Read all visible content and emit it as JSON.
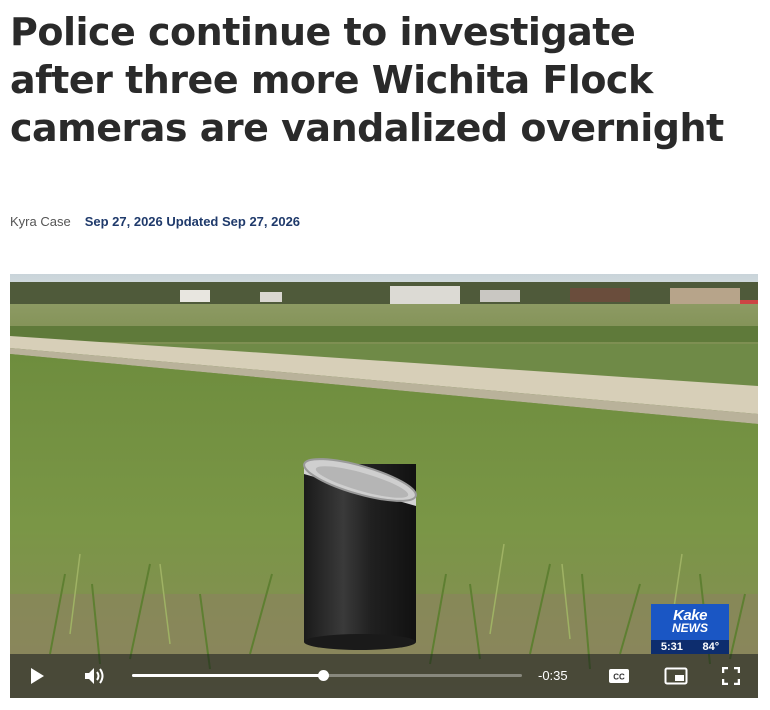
{
  "article": {
    "headline": "Police continue to investigate after three more Wichita Flock cameras are vandalized overnight",
    "author": "Kyra Case",
    "dates": "Sep 27, 2026 Updated Sep 27, 2026"
  },
  "video": {
    "logo": {
      "brand": "Kake",
      "sub": "NEWS",
      "time": "5:31",
      "temp": "84°"
    },
    "player": {
      "time_remaining": "-0:35",
      "progress_fraction": 0.49,
      "cc_label": "CC"
    }
  },
  "icons": [
    "play-icon",
    "volume-icon",
    "cc-icon",
    "picture-in-picture-icon",
    "fullscreen-icon"
  ],
  "colors": {
    "date_text": "#1f3a6b",
    "logo_blue": "#1a56c4"
  }
}
